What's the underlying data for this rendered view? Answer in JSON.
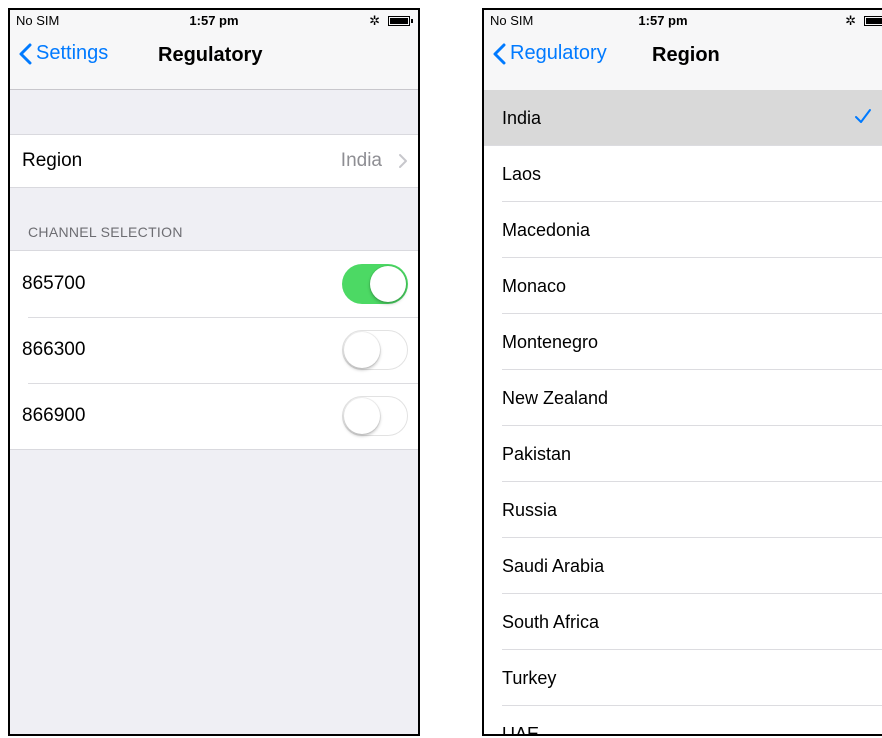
{
  "left": {
    "status": {
      "carrier": "No SIM",
      "time": "1:57 pm"
    },
    "nav": {
      "back_label": "Settings",
      "title": "Regulatory"
    },
    "region_row": {
      "label": "Region",
      "value": "India"
    },
    "channel_section": {
      "header": "CHANNEL SELECTION",
      "channels": [
        {
          "label": "865700",
          "enabled": true
        },
        {
          "label": "866300",
          "enabled": false
        },
        {
          "label": "866900",
          "enabled": false
        }
      ]
    }
  },
  "right": {
    "status": {
      "carrier": "No SIM",
      "time": "1:57 pm"
    },
    "nav": {
      "back_label": "Regulatory",
      "title": "Region"
    },
    "regions": [
      "India",
      "Laos",
      "Macedonia",
      "Monaco",
      "Montenegro",
      "New Zealand",
      "Pakistan",
      "Russia",
      "Saudi Arabia",
      "South Africa",
      "Turkey",
      "UAE"
    ],
    "selected_region": "India"
  },
  "colors": {
    "accent": "#007aff",
    "toggle_on": "#4cd964",
    "background": "#efeff4"
  }
}
